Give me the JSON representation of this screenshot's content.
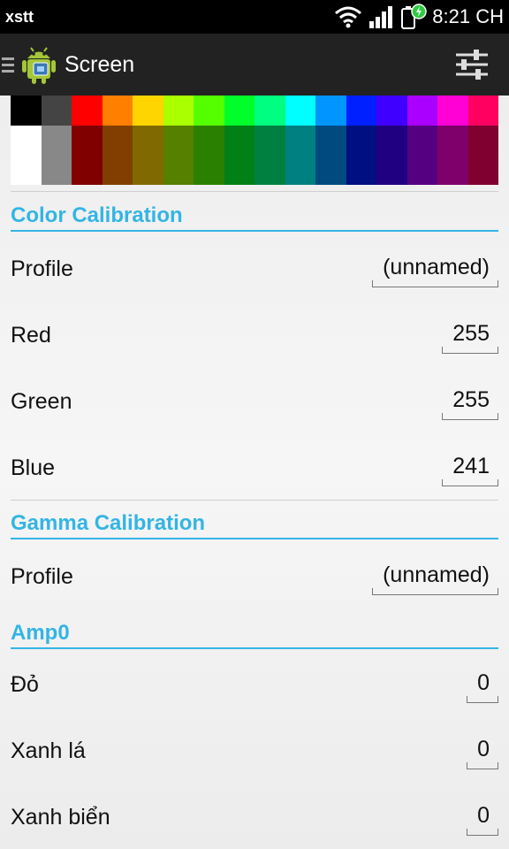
{
  "status_bar": {
    "carrier": "xstt",
    "time": "8:21 CH"
  },
  "action_bar": {
    "title": "Screen",
    "app_icon": "android-icon",
    "settings_icon": "sliders-icon"
  },
  "swatches": [
    {
      "top": "#000000",
      "bottom": "#ffffff"
    },
    {
      "top": "#444444",
      "bottom": "#888888"
    },
    {
      "top": "#ff0000",
      "bottom": "#800000"
    },
    {
      "top": "#ff7f00",
      "bottom": "#803f00"
    },
    {
      "top": "#ffd500",
      "bottom": "#806a00"
    },
    {
      "top": "#aaff00",
      "bottom": "#558000"
    },
    {
      "top": "#55ff00",
      "bottom": "#2a8000"
    },
    {
      "top": "#00ff2a",
      "bottom": "#008015"
    },
    {
      "top": "#00ff80",
      "bottom": "#008040"
    },
    {
      "top": "#00ffff",
      "bottom": "#008080"
    },
    {
      "top": "#0095ff",
      "bottom": "#004a80"
    },
    {
      "top": "#0020ff",
      "bottom": "#001080"
    },
    {
      "top": "#4000ff",
      "bottom": "#200080"
    },
    {
      "top": "#aa00ff",
      "bottom": "#550080"
    },
    {
      "top": "#ff00d5",
      "bottom": "#80006a"
    },
    {
      "top": "#ff0060",
      "bottom": "#800030"
    }
  ],
  "color_calibration": {
    "header": "Color Calibration",
    "profile_label": "Profile",
    "profile_value": "(unnamed)",
    "red_label": "Red",
    "red_value": "255",
    "green_label": "Green",
    "green_value": "255",
    "blue_label": "Blue",
    "blue_value": "241"
  },
  "gamma_calibration": {
    "header": "Gamma Calibration",
    "profile_label": "Profile",
    "profile_value": "(unnamed)"
  },
  "amp0": {
    "header": "Amp0",
    "red_label": "Đỏ",
    "red_value": "0",
    "green_label": "Xanh lá",
    "green_value": "0",
    "blue_label": "Xanh biển",
    "blue_value": "0"
  }
}
